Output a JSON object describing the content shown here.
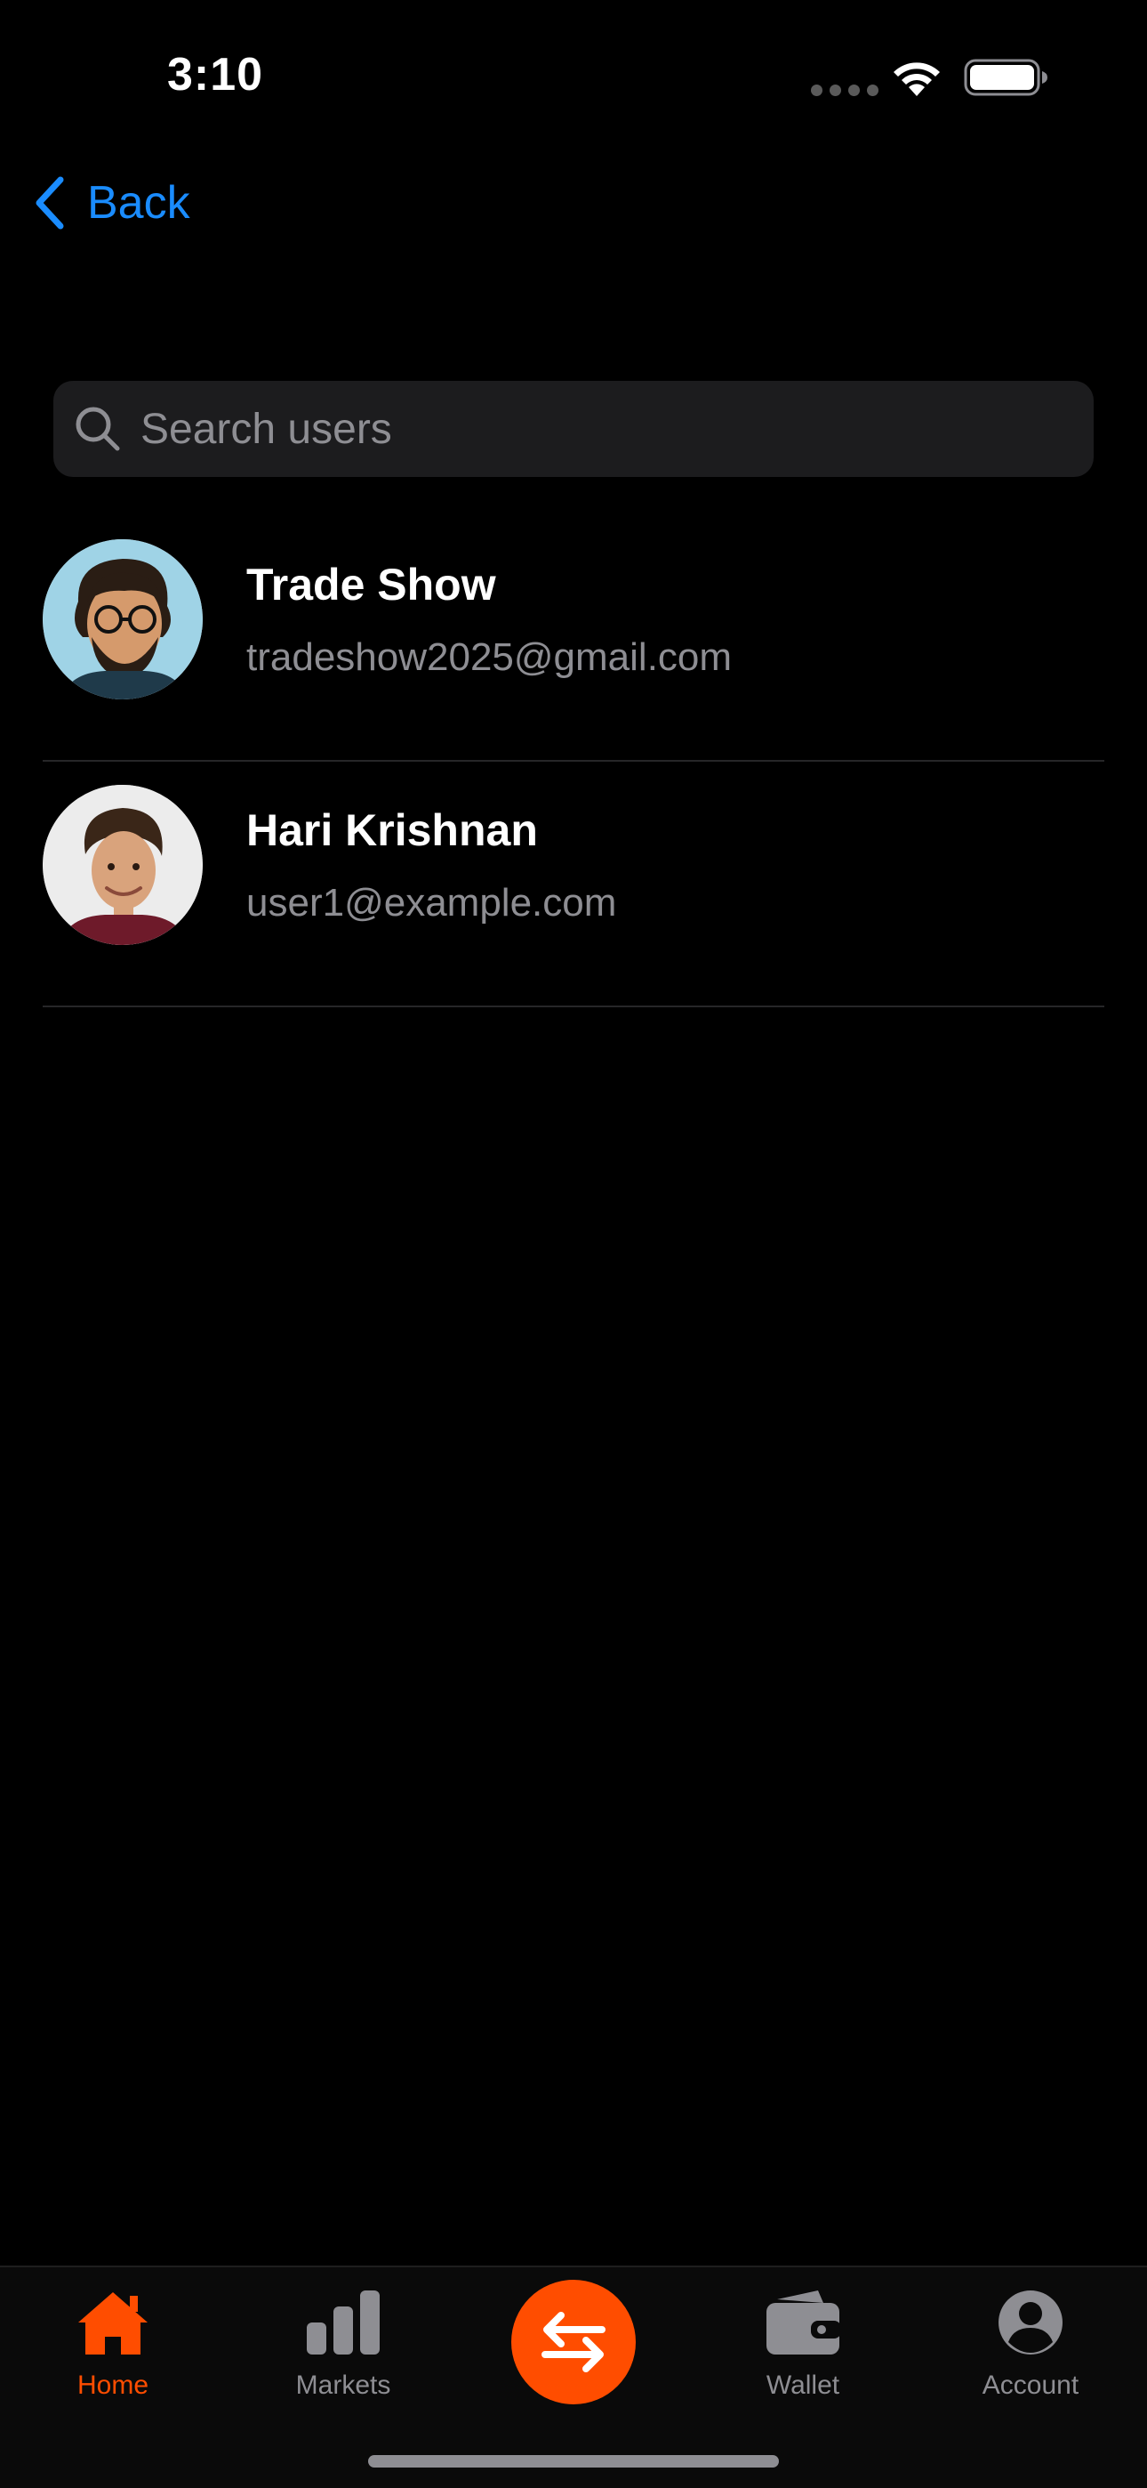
{
  "status_bar": {
    "time": "3:10",
    "icons": [
      "signal-dots-icon",
      "wifi-icon",
      "battery-icon"
    ]
  },
  "nav": {
    "back_label": "Back",
    "back_icon": "chevron-left-icon"
  },
  "search": {
    "placeholder": "Search users",
    "value": "",
    "icon": "search-icon"
  },
  "users": [
    {
      "name": "Trade Show",
      "email": "tradeshow2025@gmail.com"
    },
    {
      "name": "Hari Krishnan",
      "email": "user1@example.com"
    }
  ],
  "tab_bar": {
    "active": "Home",
    "items": [
      {
        "label": "Home",
        "icon": "home-icon"
      },
      {
        "label": "Markets",
        "icon": "bar-chart-icon"
      },
      {
        "label": "",
        "icon": "swap-arrows-icon"
      },
      {
        "label": "Wallet",
        "icon": "wallet-icon"
      },
      {
        "label": "Account",
        "icon": "person-circle-icon"
      }
    ]
  },
  "colors": {
    "background": "#000000",
    "accent": "#ff4d00",
    "link": "#1a8cff",
    "secondary_text": "#8e8e93",
    "search_bg": "#1c1c1e"
  }
}
